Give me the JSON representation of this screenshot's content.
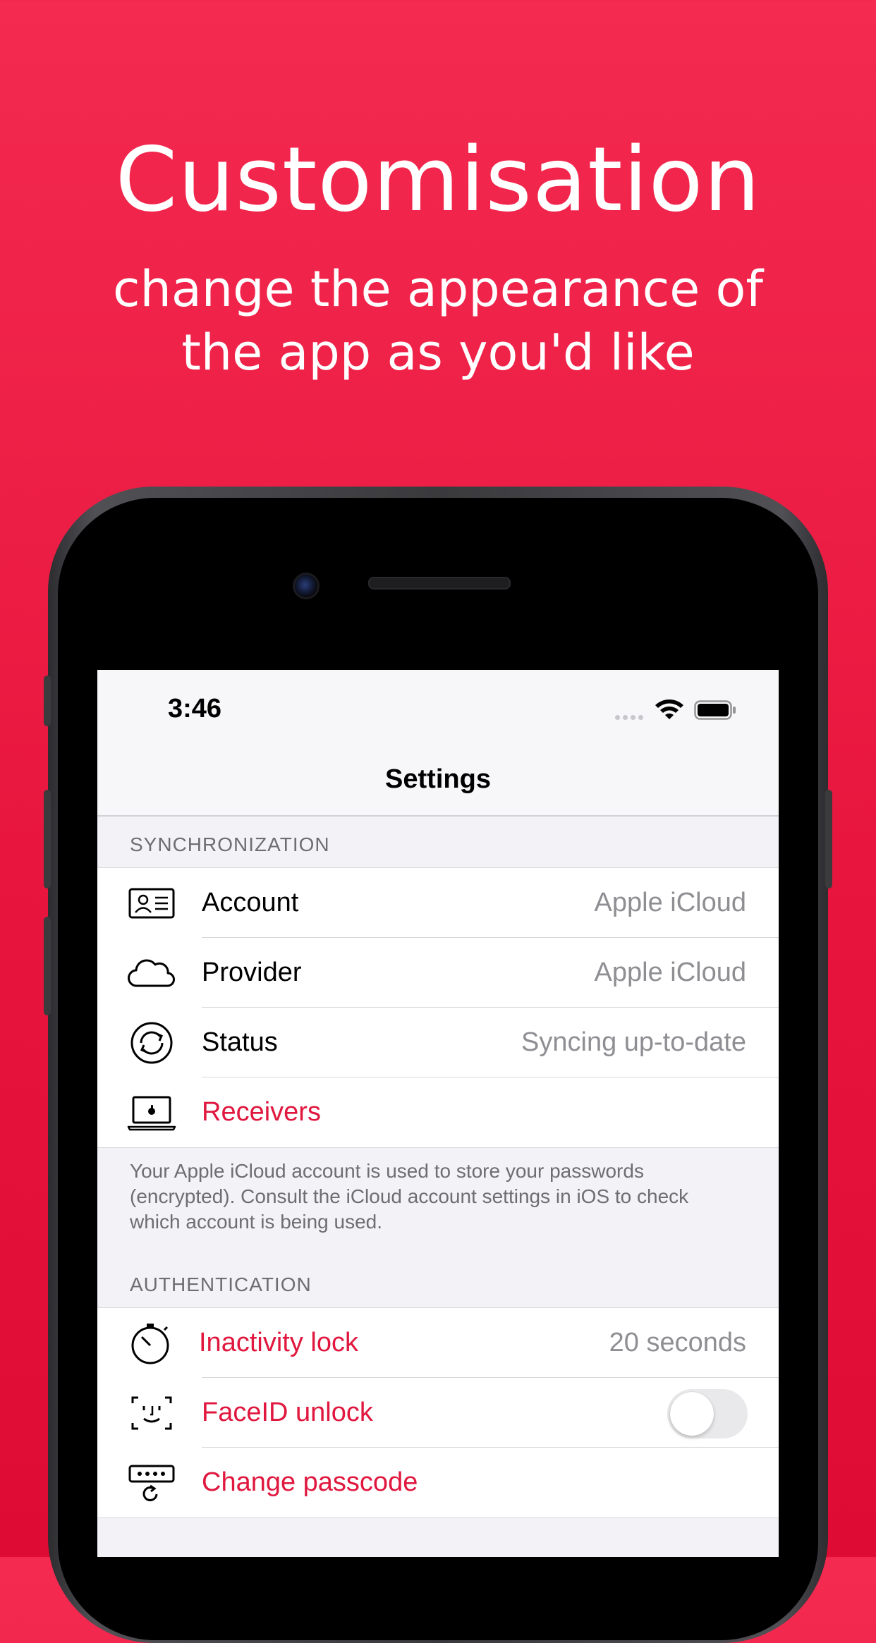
{
  "headline": "Customisation",
  "subline": {
    "line1": "change the appearance of",
    "line2": "the app as you'd like"
  },
  "colors": {
    "background": "#EA1B42",
    "accent": "#E0173E"
  },
  "status_bar": {
    "time": "3:46"
  },
  "nav": {
    "title": "Settings"
  },
  "sections": [
    {
      "header": "SYNCHRONIZATION",
      "rows": [
        {
          "icon": "contact-card-icon",
          "label": "Account",
          "value": "Apple iCloud"
        },
        {
          "icon": "cloud-icon",
          "label": "Provider",
          "value": "Apple iCloud"
        },
        {
          "icon": "sync-icon",
          "label": "Status",
          "value": "Syncing up-to-date"
        },
        {
          "icon": "laptop-icon",
          "label": "Receivers",
          "value": ""
        }
      ],
      "footer": "Your Apple iCloud account is used to store your passwords (encrypted). Consult the iCloud account settings in iOS to check which account is being used."
    },
    {
      "header": "AUTHENTICATION",
      "rows": [
        {
          "icon": "stopwatch-icon",
          "label": "Inactivity lock",
          "value": "20 seconds"
        },
        {
          "icon": "faceid-icon",
          "label": "FaceID unlock",
          "toggle": false
        },
        {
          "icon": "passcode-icon",
          "label": "Change passcode",
          "value": ""
        }
      ]
    }
  ]
}
